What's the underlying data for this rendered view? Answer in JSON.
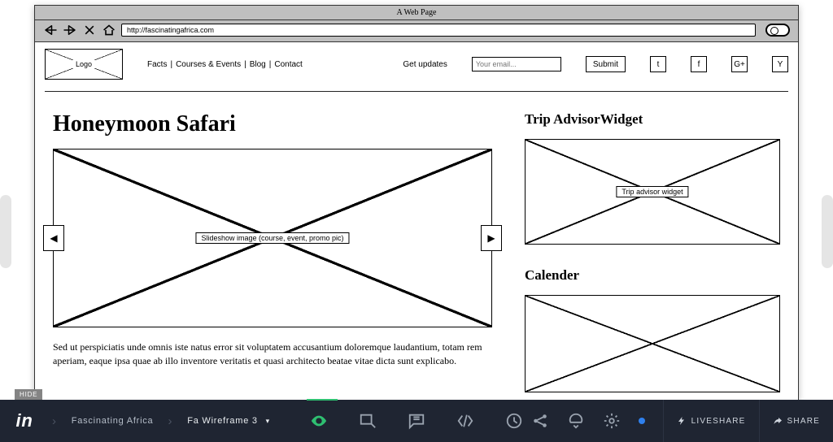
{
  "wireframe": {
    "browser": {
      "title": "A Web Page",
      "url": "http://fascinatingafrica.com"
    },
    "logo_label": "Logo",
    "nav": {
      "facts": "Facts",
      "courses": "Courses & Events",
      "blog": "Blog",
      "contact": "Contact",
      "sep": " | "
    },
    "subscribe": {
      "label": "Get updates",
      "placeholder": "Your email...",
      "submit": "Submit"
    },
    "social": {
      "t": "t",
      "f": "f",
      "g": "G+",
      "y": "Y"
    },
    "main": {
      "heading": "Honeymoon Safari",
      "slideshow_label": "Slideshow image (course, event, promo pic)",
      "paragraph": "Sed ut perspiciatis unde omnis iste natus error sit voluptatem accusantium doloremque laudantium, totam rem aperiam, eaque ipsa quae ab illo inventore veritatis et quasi architecto beatae vitae dicta sunt explicabo."
    },
    "sidebar": {
      "ta_heading": "Trip AdvisorWidget",
      "ta_label": "Trip advisor widget",
      "cal_heading": "Calender"
    }
  },
  "invision": {
    "hide": "HIDE",
    "crumb_project": "Fascinating Africa",
    "crumb_screen": "Fa Wireframe 3",
    "liveshare": "LIVESHARE",
    "share": "SHARE"
  }
}
